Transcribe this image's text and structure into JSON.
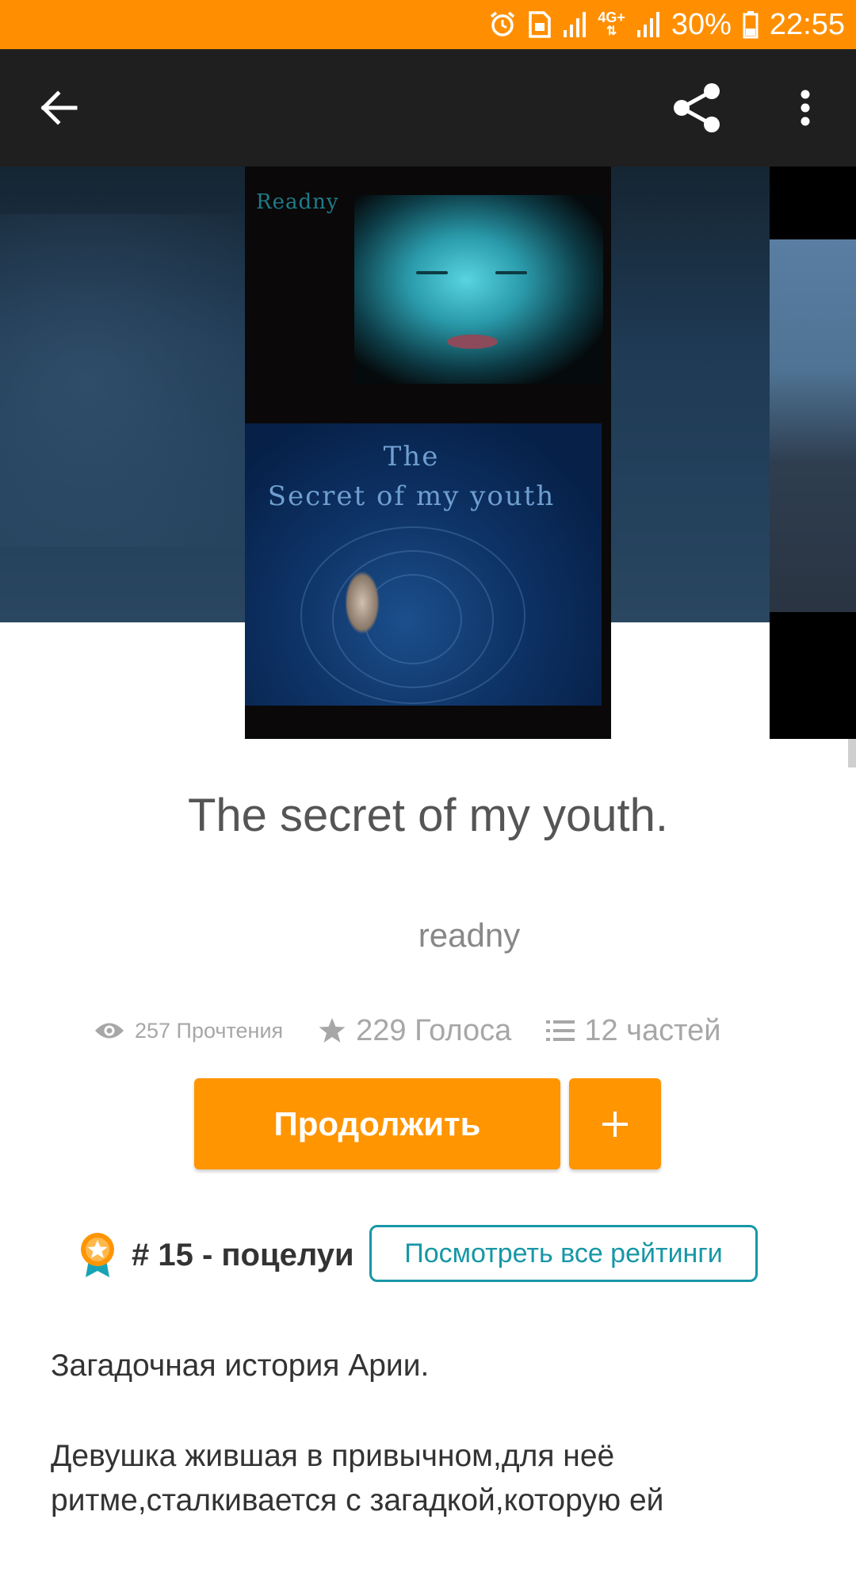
{
  "status_bar": {
    "battery": "30%",
    "time": "22:55",
    "network": "4G+",
    "icons": [
      "alarm-icon",
      "sim-icon",
      "signal-icon",
      "network-4g-icon",
      "signal-icon",
      "battery-icon"
    ],
    "background": "#ff8f00"
  },
  "toolbar": {
    "back_icon": "arrow-left-icon",
    "share_icon": "share-icon",
    "more_icon": "more-vertical-icon",
    "background": "#1f1f1f"
  },
  "cover": {
    "brand": "Readny",
    "title_line1": "The",
    "title_line2": "Secret of my youth"
  },
  "story": {
    "title": "The secret of my youth.",
    "author": "readny"
  },
  "stats": {
    "reads": "257 Прочтения",
    "votes": "229 Голоса",
    "parts": "12 частей"
  },
  "actions": {
    "continue_label": "Продолжить",
    "add_label": "+",
    "accent": "#ff9500"
  },
  "ranking": {
    "label": "# 15 - поцелуи",
    "view_all_label": "Посмотреть все рейтинги",
    "accent": "#1797a6"
  },
  "description": {
    "paragraphs": [
      "Загадочная история Арии.",
      "Девушка жившая в привычном,для неё ритме,сталкивается с загадкой,которую ей"
    ]
  }
}
